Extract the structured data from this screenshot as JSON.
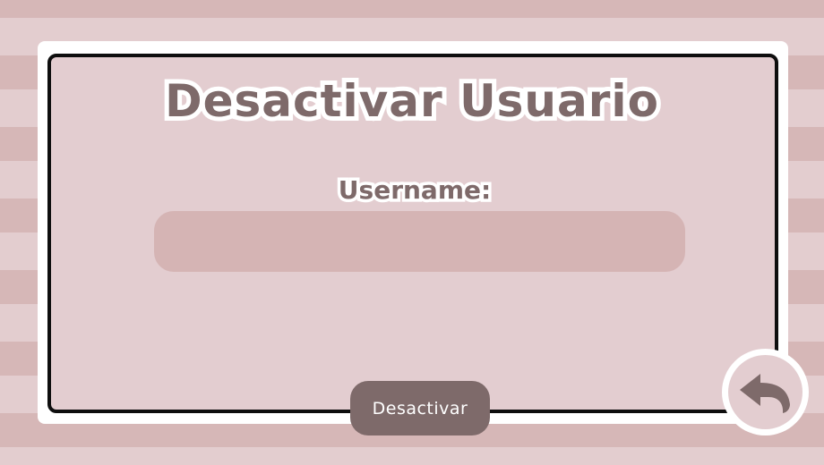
{
  "page": {
    "title": "Desactivar Usuario"
  },
  "form": {
    "username_label": "Username:",
    "username_value": "",
    "submit_label": "Desactivar"
  },
  "icons": {
    "back": "back-arrow-icon"
  },
  "colors": {
    "stripe_dark": "#d6b7b7",
    "stripe_light": "#e3cdcf",
    "panel": "#e3cdd0",
    "input": "#d5b4b4",
    "accent": "#7e6a6a",
    "border": "#0e0e0e"
  }
}
